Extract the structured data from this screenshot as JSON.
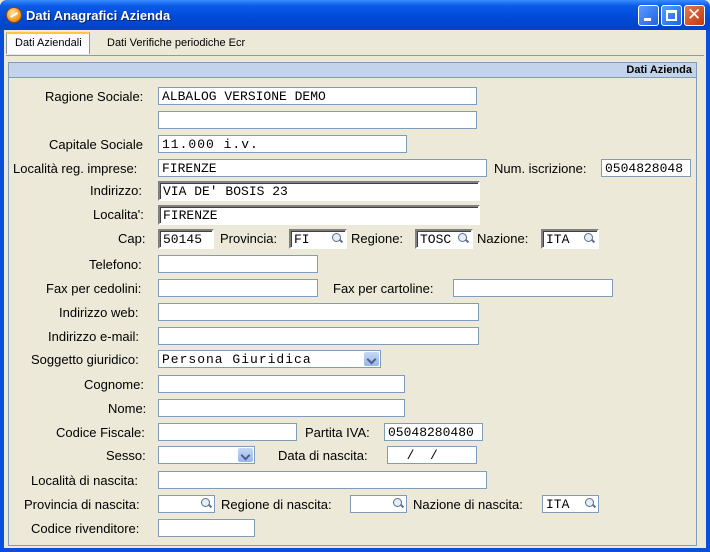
{
  "window": {
    "title": "Dati Anagrafici Azienda"
  },
  "tabs": [
    "Dati Aziendali",
    "Dati Verifiche periodiche Ecr"
  ],
  "section": {
    "title": "Dati Azienda"
  },
  "labels": {
    "ragione_sociale": "Ragione Sociale:",
    "capitale_sociale": "Capitale Sociale",
    "localita_reg": "Località reg. imprese:",
    "num_iscrizione": "Num. iscrizione:",
    "indirizzo": "Indirizzo:",
    "localita": "Localita':",
    "cap": "Cap:",
    "provincia": "Provincia:",
    "regione": "Regione:",
    "nazione": "Nazione:",
    "telefono": "Telefono:",
    "fax_cedolini": "Fax per cedolini:",
    "fax_cartoline": "Fax per cartoline:",
    "indirizzo_web": "Indirizzo web:",
    "indirizzo_email": "Indirizzo e-mail:",
    "soggetto_giuridico": "Soggetto giuridico:",
    "cognome": "Cognome:",
    "nome": "Nome:",
    "codice_fiscale": "Codice Fiscale:",
    "partita_iva": "Partita IVA:",
    "sesso": "Sesso:",
    "data_nascita": "Data di nascita:",
    "localita_nascita": "Località di nascita:",
    "provincia_nascita": "Provincia di nascita:",
    "regione_nascita": "Regione di nascita:",
    "nazione_nascita": "Nazione di nascita:",
    "codice_rivenditore": "Codice rivenditore:"
  },
  "values": {
    "ragione_sociale_1": "ALBALOG VERSIONE DEMO",
    "ragione_sociale_2": "",
    "capitale_sociale": "11.000 i.v.",
    "localita_reg": "FIRENZE",
    "num_iscrizione": "0504828048",
    "indirizzo": "VIA DE' BOSIS 23",
    "localita": "FIRENZE",
    "cap": "50145",
    "provincia": "FI",
    "regione": "TOSC",
    "nazione": "ITA",
    "telefono": "",
    "fax_cedolini": "",
    "fax_cartoline": "",
    "indirizzo_web": "",
    "indirizzo_email": "",
    "soggetto_giuridico": "Persona Giuridica",
    "cognome": "",
    "nome": "",
    "codice_fiscale": "",
    "partita_iva": "05048280480",
    "sesso": "",
    "data_nascita": "  /  /",
    "localita_nascita": "",
    "provincia_nascita": "",
    "regione_nascita": "",
    "nazione_nascita": "ITA",
    "codice_rivenditore": ""
  },
  "colors": {
    "titlebar": "#0054E3",
    "face": "#ECE9D8",
    "section_header": "#C3D4EA",
    "field_border": "#7F9DB9"
  }
}
